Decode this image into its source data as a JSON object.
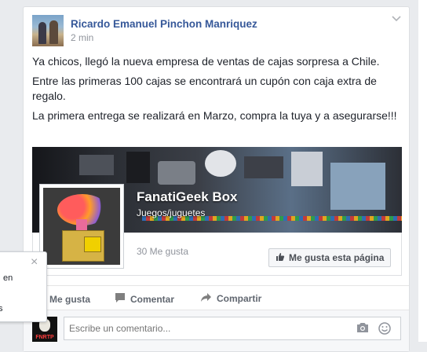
{
  "post": {
    "author": "Ricardo Emanuel Pinchon Manriquez",
    "time": "2 min",
    "paragraphs": [
      "Ya chicos, llegó la nueva empresa de ventas de cajas sorpresa a Chile.",
      "Entre las primeras 100 cajas se encontrará un cupón con caja extra de regalo.",
      "La primera entrega se realizará en Marzo, compra la tuya y a asegurarse!!!"
    ]
  },
  "shared_page": {
    "name": "FanatiGeek Box",
    "category": "Juegos/juguetes",
    "likes": "30 Me gusta",
    "like_button": "Me gusta esta página"
  },
  "actions": {
    "like": "Me gusta",
    "comment": "Comentar",
    "share": "Compartir"
  },
  "comment": {
    "placeholder": "Escribe un comentario..."
  },
  "popup": {
    "text": "en",
    "text2": "s",
    "close": "×"
  },
  "icons": {
    "chevron": "chevron-down-icon",
    "thumb": "thumbs-up-icon",
    "comment": "comment-bubble-icon",
    "share": "share-arrow-icon",
    "camera": "camera-icon",
    "emoji": "emoji-icon"
  },
  "colors": {
    "author_link": "#365899",
    "meta": "#90949c",
    "background": "#e9ebee"
  }
}
